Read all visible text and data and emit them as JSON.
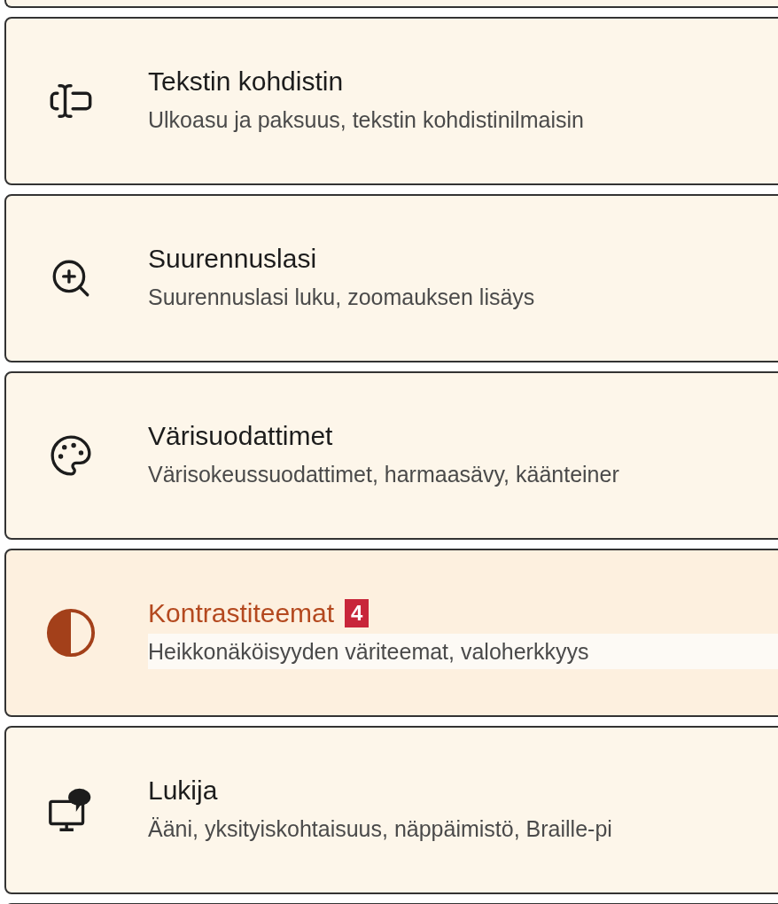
{
  "items": [
    {
      "title": "Tekstin kohdistin",
      "subtitle": "Ulkoasu ja paksuus, tekstin kohdistinilmaisin",
      "hovered": false
    },
    {
      "title": "Suurennuslasi",
      "subtitle": "Suurennuslasi luku, zoomauksen lisäys",
      "hovered": false
    },
    {
      "title": "Värisuodattimet",
      "subtitle": "Värisokeussuodattimet, harmaasävy, käänteiner",
      "hovered": false
    },
    {
      "title": "Kontrastiteemat",
      "badge": "4",
      "subtitle": "Heikkonäköisyyden väriteemat, valoherkkyys",
      "hovered": true
    },
    {
      "title": "Lukija",
      "subtitle": "Ääni, yksityiskohtaisuus, näppäimistö, Braille-pi",
      "hovered": false
    }
  ]
}
